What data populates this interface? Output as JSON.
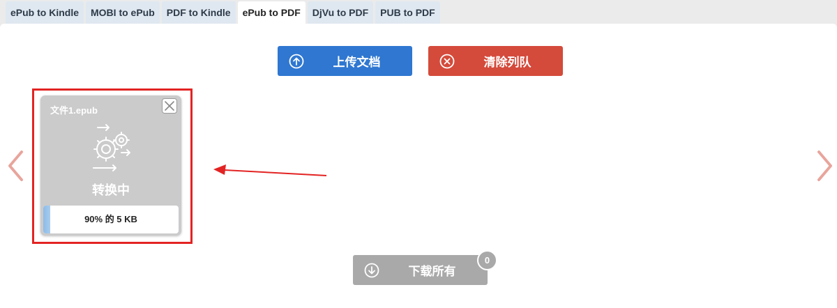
{
  "tabs": [
    {
      "label": "ePub to Kindle",
      "active": false
    },
    {
      "label": "MOBI to ePub",
      "active": false
    },
    {
      "label": "PDF to Kindle",
      "active": false
    },
    {
      "label": "ePub to PDF",
      "active": true
    },
    {
      "label": "DjVu to PDF",
      "active": false
    },
    {
      "label": "PUB to PDF",
      "active": false
    }
  ],
  "toolbar": {
    "upload_label": "上传文档",
    "upload_icon": "upload-circle-icon",
    "clear_label": "清除列队",
    "clear_icon": "clear-circle-icon",
    "upload_color": "#2f77d1",
    "clear_color": "#d44a3b"
  },
  "file_card": {
    "name": "文件1.epub",
    "status": "转换中",
    "progress_text": "90% 的 5 KB",
    "progress_percent": 5,
    "icon": "gear-converting-icon",
    "close_icon": "close-icon"
  },
  "navigation": {
    "prev_icon": "chevron-left-icon",
    "next_icon": "chevron-right-icon"
  },
  "download": {
    "label": "下载所有",
    "icon": "download-circle-icon",
    "count": "0"
  },
  "annotation": {
    "highlight_color": "#e32323"
  }
}
